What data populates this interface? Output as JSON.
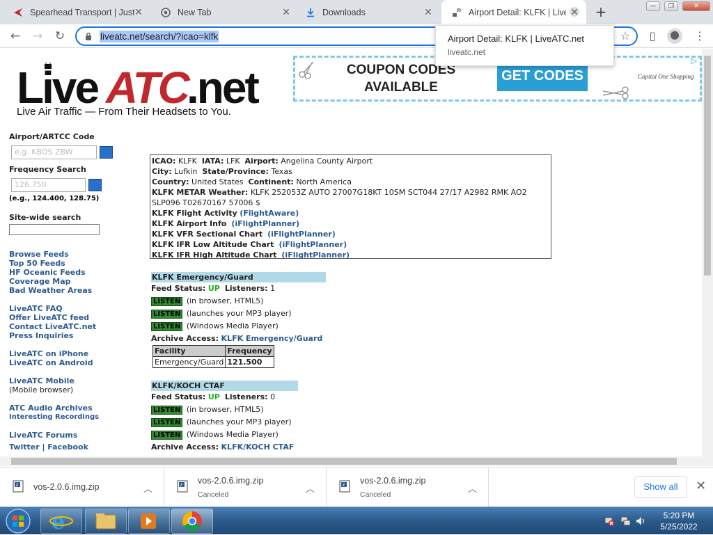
{
  "browser": {
    "tabs": [
      {
        "title": "Spearhead Transport | Just",
        "active": false
      },
      {
        "title": "New Tab",
        "active": false
      },
      {
        "title": "Downloads",
        "active": false
      },
      {
        "title": "Airport Detail: KLFK | LiveA",
        "active": true
      }
    ],
    "url": "liveatc.net/search/?icao=klfk",
    "tooltip": {
      "title": "Airport Detail: KLFK | LiveATC.net",
      "domain": "liveatc.net"
    }
  },
  "site": {
    "logo_text": "LiveATC.net",
    "tagline": "Live Air Traffic — From Their Headsets to You.",
    "ad": {
      "text_line1": "COUPON CODES",
      "text_line2": "AVAILABLE",
      "button": "GET CODES",
      "brand": "Capital One Shopping"
    }
  },
  "sidebar": {
    "code_label": "Airport/ARTCC Code",
    "code_placeholder": "e.g. KBOS ZBW",
    "freq_label": "Frequency Search",
    "freq_placeholder": "126.750",
    "freq_example": "(e.g., 124.400, 128.75)",
    "site_search_label": "Site-wide search",
    "group1": [
      "Browse Feeds",
      "Top 50 Feeds",
      "HF Oceanic Feeds",
      "Coverage Map",
      "Bad Weather Areas"
    ],
    "group2": [
      "LiveATC FAQ",
      "Offer LiveATC feed",
      "Contact LiveATC.net",
      "Press Inquiries"
    ],
    "group3": [
      "LiveATC on iPhone",
      "LiveATC on Android"
    ],
    "mobile_link": "LiveATC Mobile",
    "mobile_note": "(Mobile browser)",
    "archives_link": "ATC Audio Archives",
    "recordings_link": "Interesting Recordings",
    "forums_link": "LiveATC Forums",
    "social": "Twitter | Facebook"
  },
  "airport": {
    "icao_label": "ICAO:",
    "icao": "KLFK",
    "iata_label": "IATA:",
    "iata": "LFK",
    "airport_label": "Airport:",
    "airport": "Angelina County Airport",
    "city_label": "City:",
    "city": "Lufkin",
    "state_label": "State/Province:",
    "state": "Texas",
    "country_label": "Country:",
    "country": "United States",
    "continent_label": "Continent:",
    "continent": "North America",
    "metar_label": "KLFK METAR Weather:",
    "metar": "KLFK 252053Z AUTO 27007G18KT 10SM SCT044 27/17 A2982 RMK AO2 SLP096 T02670167 57006 $",
    "rows": [
      {
        "label": "KLFK Flight Activity",
        "link": "(FlightAware)"
      },
      {
        "label": "KLFK Airport Info",
        "link": "(iFlightPlanner)"
      },
      {
        "label": "KLFK VFR Sectional Chart",
        "link": "(iFlightPlanner)"
      },
      {
        "label": "KLFK IFR Low Altitude Chart",
        "link": "(iFlightPlanner)"
      },
      {
        "label": "KLFK IFR High Altitude Chart",
        "link": "(iFlightPlanner)"
      }
    ]
  },
  "feeds": [
    {
      "name": "KLFK Emergency/Guard",
      "status_label": "Feed Status:",
      "status": "UP",
      "listeners_label": "Listeners:",
      "listeners": "1",
      "listen_label": "LISTEN",
      "options": [
        "(in browser, HTML5)",
        "(launches your MP3 player)",
        "(Windows Media Player)"
      ],
      "archive_label": "Archive Access:",
      "archive_link": "KLFK Emergency/Guard",
      "table_headers": [
        "Facility",
        "Frequency"
      ],
      "table_rows": [
        [
          "Emergency/Guard",
          "121.500"
        ]
      ]
    },
    {
      "name": "KLFK/KOCH CTAF",
      "status_label": "Feed Status:",
      "status": "UP",
      "listeners_label": "Listeners:",
      "listeners": "0",
      "listen_label": "LISTEN",
      "options": [
        "(in browser, HTML5)",
        "(launches your MP3 player)",
        "(Windows Media Player)"
      ],
      "archive_label": "Archive Access:",
      "archive_link": "KLFK/KOCH CTAF"
    }
  ],
  "downloads": {
    "items": [
      {
        "name": "vos-2.0.6.img.zip",
        "status": ""
      },
      {
        "name": "vos-2.0.6.img.zip",
        "status": "Canceled"
      },
      {
        "name": "vos-2.0.6.img.zip",
        "status": "Canceled"
      }
    ],
    "show_all": "Show all"
  },
  "taskbar": {
    "time": "5:20 PM",
    "date": "5/25/2022"
  }
}
